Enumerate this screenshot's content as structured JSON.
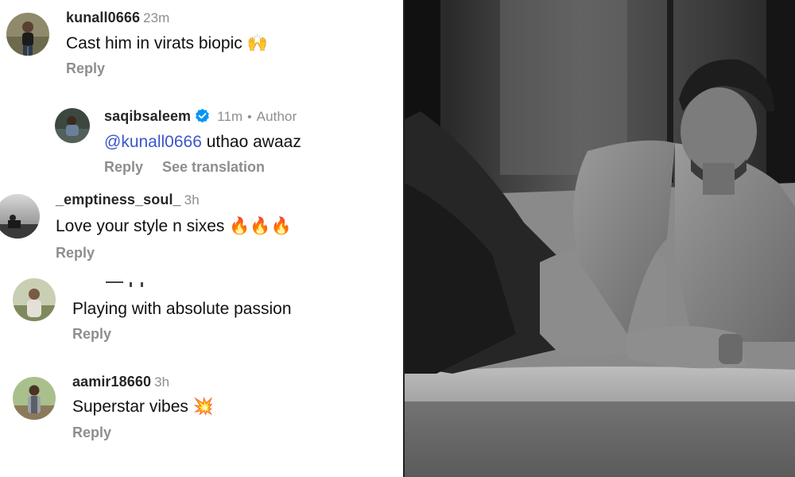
{
  "comments": [
    {
      "username": "kunall0666",
      "time": "23m",
      "text": "Cast him in virats biopic 🙌",
      "reply_label": "Reply"
    },
    {
      "username": "saqibsaleem",
      "time": "11m",
      "author_label": "Author",
      "mention": "@kunall0666",
      "text": " uthao awaaz",
      "reply_label": "Reply",
      "translate_label": "See translation"
    },
    {
      "username": "_emptiness_soul_",
      "time": "3h",
      "text": "Love your style n sixes 🔥🔥🔥",
      "reply_label": "Reply"
    },
    {
      "text": "Playing with absolute passion",
      "reply_label": "Reply"
    },
    {
      "username": "aamir18660",
      "time": "3h",
      "text": "Superstar vibes 💥",
      "reply_label": "Reply"
    }
  ],
  "icons": {
    "verified": "verified-badge-icon",
    "avatar": "avatar"
  },
  "colors": {
    "mention": "#3a57c9",
    "verified": "#0095f6",
    "secondary_text": "#8e8e8e"
  }
}
